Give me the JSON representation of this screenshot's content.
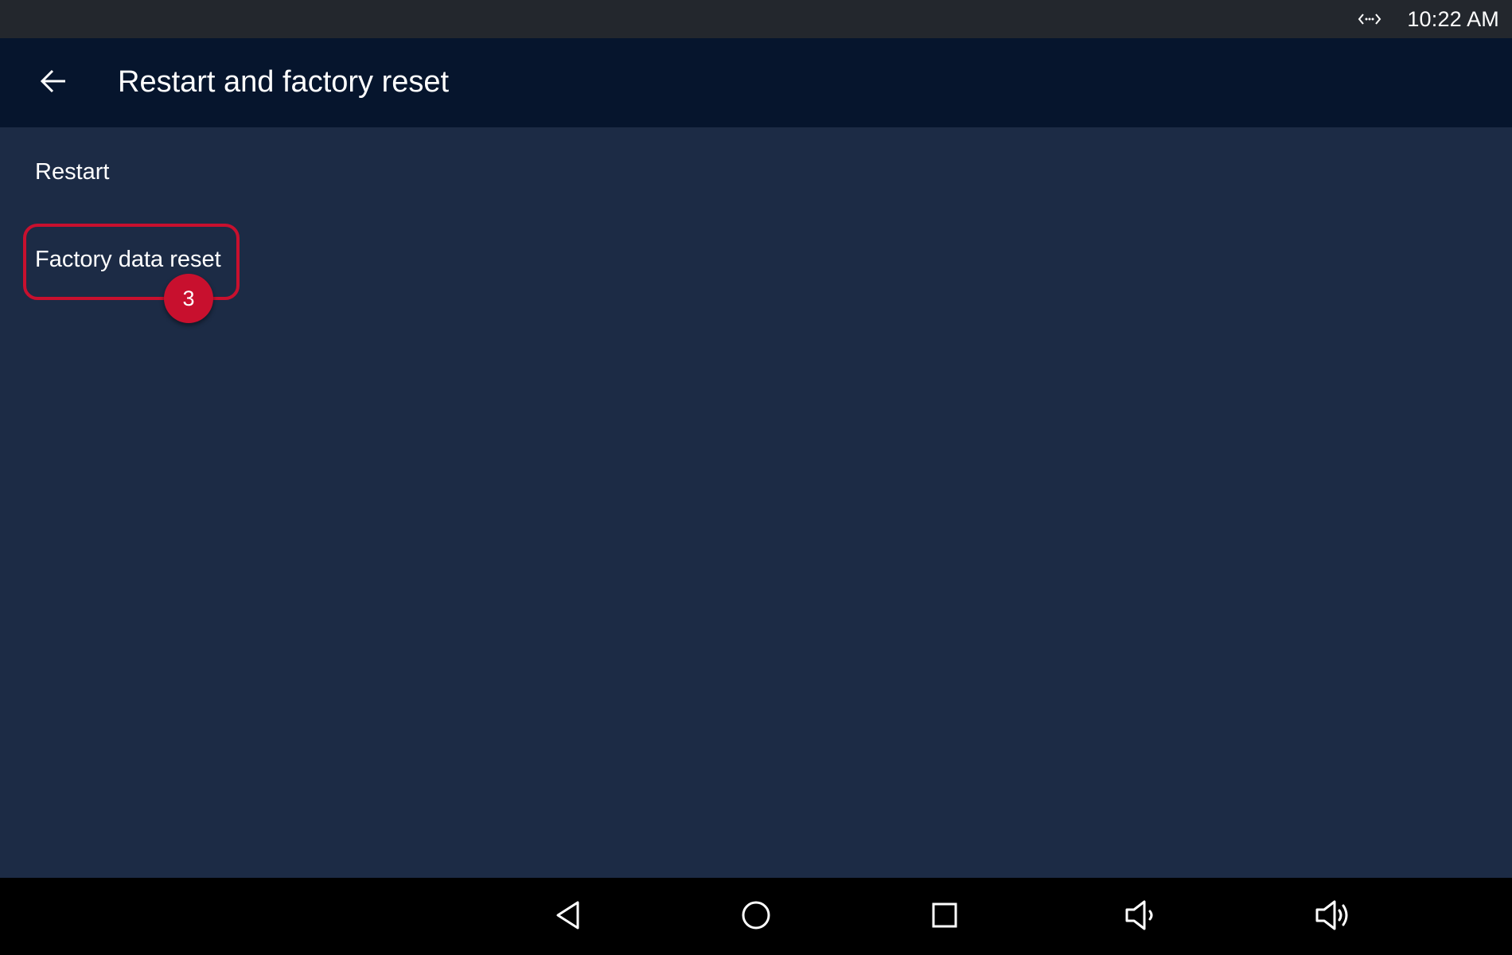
{
  "status_bar": {
    "connection_icon": "connection-arrows-icon",
    "time": "10:22 AM"
  },
  "app_bar": {
    "back_icon": "arrow-left-icon",
    "title": "Restart and factory reset"
  },
  "menu": {
    "items": [
      {
        "label": "Restart"
      },
      {
        "label": "Factory data reset"
      }
    ]
  },
  "annotation": {
    "step_number": "3",
    "color": "#c8102e"
  },
  "nav_bar": {
    "buttons": [
      {
        "icon": "triangle-back-icon"
      },
      {
        "icon": "circle-home-icon"
      },
      {
        "icon": "square-recents-icon"
      },
      {
        "icon": "volume-down-icon"
      },
      {
        "icon": "volume-up-icon"
      }
    ]
  },
  "colors": {
    "status_bar_bg": "#23272d",
    "app_bar_bg": "#06152d",
    "content_bg": "#1c2b45",
    "nav_bar_bg": "#000000",
    "highlight": "#c8102e"
  }
}
